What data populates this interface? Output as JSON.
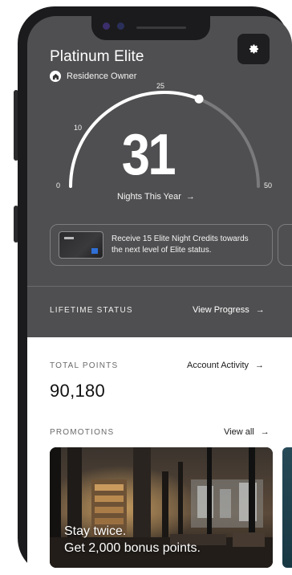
{
  "header": {
    "tier_title": "Platinum Elite",
    "owner_label": "Residence Owner",
    "settings_icon": "gear-icon"
  },
  "nights": {
    "value": "31",
    "link_label": "Nights This Year",
    "arrow": "→",
    "gauge_min_label": "0",
    "gauge_tick_10": "10",
    "gauge_tick_25": "25",
    "gauge_max_label": "50",
    "progress_value": 31,
    "gauge_max": 50
  },
  "offer": {
    "text_line1": "Receive 15 Elite Night Credits towards",
    "text_line2": "the next level of Elite status."
  },
  "lifetime": {
    "label": "LIFETIME STATUS",
    "link_label": "View Progress",
    "arrow": "→"
  },
  "points": {
    "label": "TOTAL POINTS",
    "value": "90,180",
    "link_label": "Account Activity",
    "arrow": "→"
  },
  "promotions": {
    "label": "PROMOTIONS",
    "link_label": "View all",
    "arrow": "→",
    "promo_line1": "Stay twice.",
    "promo_line2": "Get 2,000 bonus points."
  },
  "colors": {
    "dark_panel": "#4f4f51",
    "frame": "#1b1b1d",
    "accent_white": "#ffffff"
  }
}
